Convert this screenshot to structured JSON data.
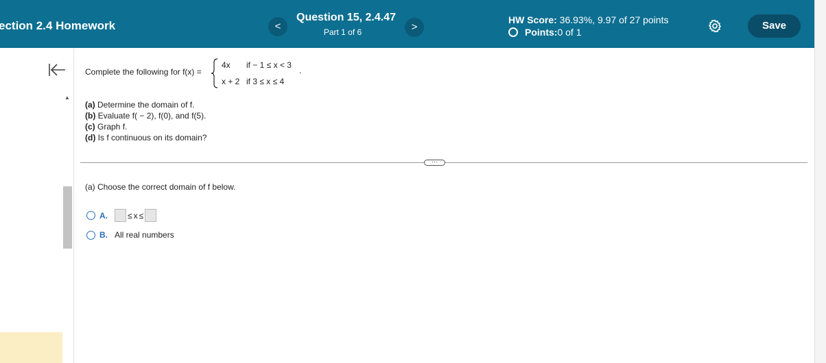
{
  "header": {
    "assignment_title": "ection 2.4 Homework",
    "prev_label": "<",
    "next_label": ">",
    "question_title": "Question 15, 2.4.47",
    "question_part": "Part 1 of 6",
    "hw_score_label": "HW Score:",
    "hw_score_value": " 36.93%, 9.97 of 27 points",
    "points_label": "Points:",
    "points_value": " 0 of 1",
    "save_label": "Save",
    "settings_icon": "gear-icon"
  },
  "question": {
    "prompt": "Complete the following for f(x) =",
    "piecewise": {
      "expr1": "4x",
      "cond1": "if  − 1 ≤ x < 3",
      "expr2": "x + 2",
      "cond2": "if  3 ≤ x ≤ 4",
      "period": "."
    },
    "parts": [
      {
        "label": "(a)",
        "text": " Determine the domain of f."
      },
      {
        "label": "(b)",
        "text": " Evaluate f( − 2), f(0), and f(5)."
      },
      {
        "label": "(c)",
        "text": " Graph f."
      },
      {
        "label": "(d)",
        "text": " Is f continuous on its domain?"
      }
    ]
  },
  "answer": {
    "more_label": "···",
    "part_a_prompt": "(a) Choose the correct domain of f below.",
    "options": [
      {
        "letter": "A.",
        "ineq1": "≤",
        "var": "x",
        "ineq2": "≤"
      },
      {
        "letter": "B.",
        "text": "All real numbers"
      }
    ]
  },
  "colors": {
    "header_bg": "#0d6f91",
    "save_bg": "#0a4d68",
    "option_blue": "#2a6fb5",
    "yellow_block": "#fbeec4"
  }
}
